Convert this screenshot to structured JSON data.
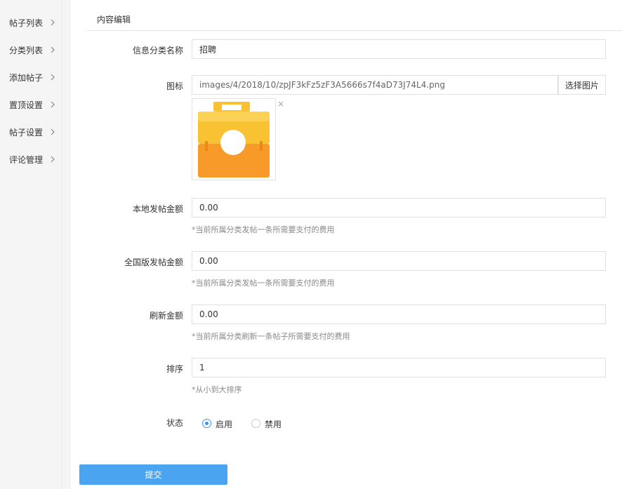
{
  "sidebar": {
    "items": [
      {
        "label": "帖子列表"
      },
      {
        "label": "分类列表"
      },
      {
        "label": "添加帖子"
      },
      {
        "label": "置顶设置"
      },
      {
        "label": "帖子设置"
      },
      {
        "label": "评论管理"
      }
    ]
  },
  "header": {
    "title": "内容编辑"
  },
  "form": {
    "name": {
      "label": "信息分类名称",
      "value": "招聘"
    },
    "icon": {
      "label": "图标",
      "value": "images/4/2018/10/zpJF3kFz5zF3A5666s7f4aD73J74L4.png",
      "pick_label": "选择图片",
      "remove_label": "×"
    },
    "local_fee": {
      "label": "本地发帖金额",
      "value": "0.00",
      "hint": "*当前所属分类发帖一条所需要支付的费用"
    },
    "national_fee": {
      "label": "全国版发帖金额",
      "value": "0.00",
      "hint": "*当前所属分类发帖一条所需要支付的费用"
    },
    "refresh_fee": {
      "label": "刷新金额",
      "value": "0.00",
      "hint": "*当前所属分类刷新一条帖子所需要支付的费用"
    },
    "sort": {
      "label": "排序",
      "value": "1",
      "hint": "*从小到大排序"
    },
    "status": {
      "label": "状态",
      "options": [
        "启用",
        "禁用"
      ],
      "selected": "启用"
    },
    "submit_label": "提交"
  },
  "colors": {
    "accent": "#4aa4f0",
    "radio": "#3a96e8",
    "icon_top": "#f8c232",
    "icon_body": "#f79a2a"
  }
}
